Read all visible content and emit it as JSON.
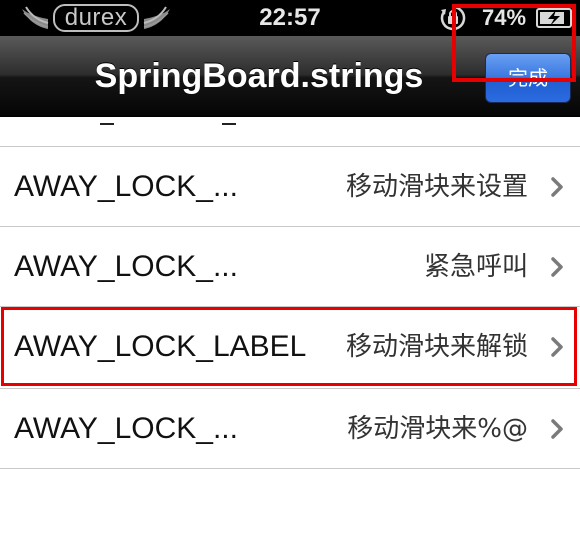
{
  "status_bar": {
    "carrier": "durex",
    "time": "22:57",
    "battery_percent": "74%",
    "icons": [
      "orientation-lock-icon",
      "battery-charging-icon"
    ]
  },
  "nav_bar": {
    "title": "SpringBoard.strings",
    "done_label": "完成",
    "done_color": "#2b6ae0"
  },
  "rows": [
    {
      "key": "AWAY_LOCK_...",
      "value": "移动滑块来设置"
    },
    {
      "key": "AWAY_LOCK_...",
      "value": "紧急呼叫"
    },
    {
      "key": "AWAY_LOCK_LABEL",
      "value": "移动滑块来解锁"
    },
    {
      "key": "AWAY_LOCK_...",
      "value": "移动滑块来%@"
    }
  ],
  "highlight_color": "#e60000"
}
